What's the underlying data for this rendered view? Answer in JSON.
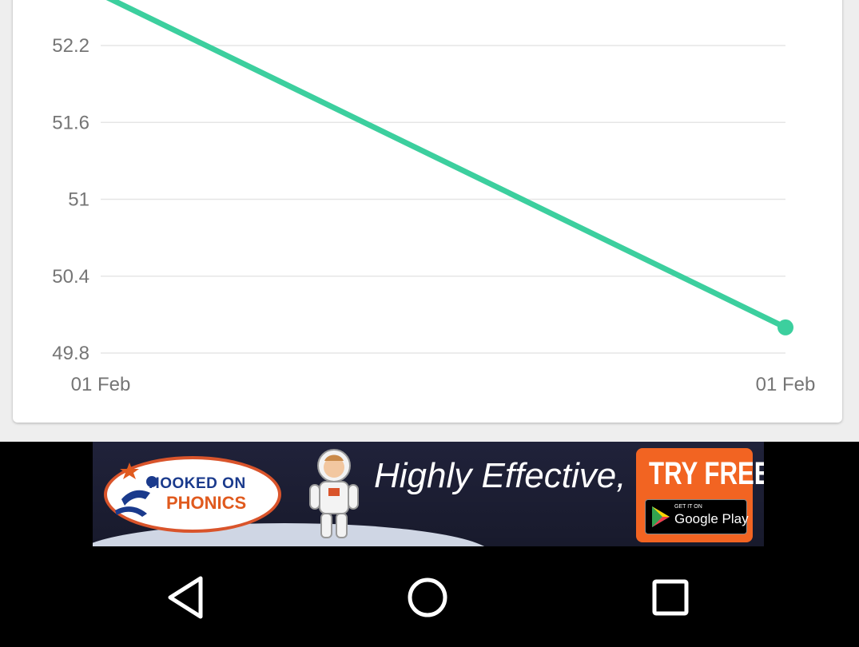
{
  "chart_data": {
    "type": "line",
    "x": [
      "01 Feb",
      "01 Feb"
    ],
    "x_tick_labels": [
      "01 Feb",
      "01 Feb"
    ],
    "y_ticks": [
      52.2,
      51.6,
      51,
      50.4,
      49.8
    ],
    "y_tick_labels": [
      "52.2",
      "51.6",
      "51",
      "50.4",
      "49.8"
    ],
    "ylim": [
      49.8,
      52.2
    ],
    "series": [
      {
        "values": [
          52.6,
          50.0
        ],
        "color": "#3ccf9e"
      }
    ],
    "grid": true
  },
  "ad": {
    "brand_line1": "HOOKED ON",
    "brand_line2": "PHONICS",
    "tagline": "Highly Effective,",
    "cta": "TRY FREE",
    "store_small": "GET IT ON",
    "store_name": "Google Play"
  },
  "navbar": {
    "back_icon": "back-triangle-icon",
    "home_icon": "home-circle-icon",
    "recents_icon": "recents-square-icon"
  }
}
